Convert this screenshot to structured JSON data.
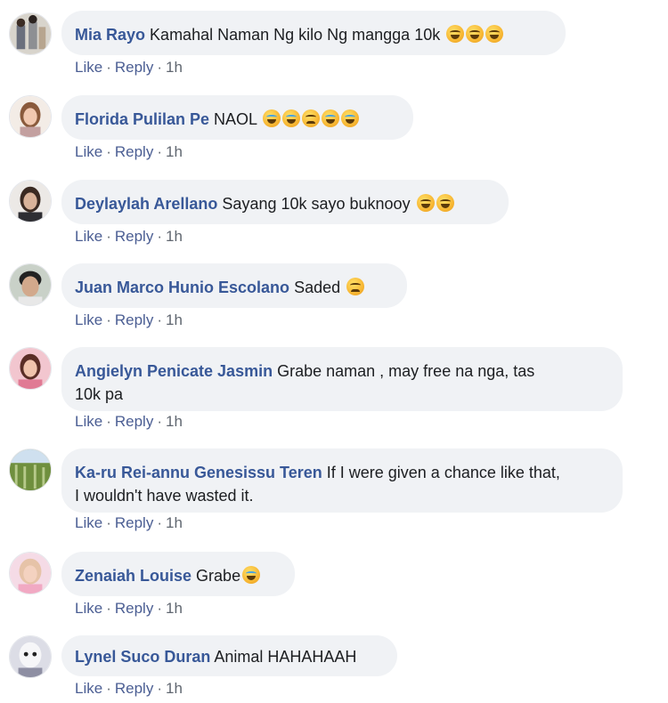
{
  "comments": [
    {
      "author": "Mia Rayo",
      "text": "Kamahal Naman Ng kilo Ng mangga 10k",
      "emoji": "🤣🤣🤣",
      "like": "Like",
      "reply": "Reply",
      "time": "1h"
    },
    {
      "author": "Florida Pulilan Pe",
      "text": "NAOL",
      "emoji": "😂😂😦😂😂",
      "like": "Like",
      "reply": "Reply",
      "time": "1h"
    },
    {
      "author": "Deylaylah Arellano",
      "text": "Sayang 10k sayo buknooy",
      "emoji": "😅🤣",
      "like": "Like",
      "reply": "Reply",
      "time": "1h"
    },
    {
      "author": "Juan Marco Hunio Escolano",
      "text": "Saded",
      "emoji": "😞",
      "like": "Like",
      "reply": "Reply",
      "time": "1h"
    },
    {
      "author": "Angielyn Penicate Jasmin",
      "text": "Grabe naman , may free na nga, tas",
      "text2": "10k pa",
      "like": "Like",
      "reply": "Reply",
      "time": "1h"
    },
    {
      "author": "Ka-ru Rei-annu Genesissu Teren",
      "text": "If I were given a chance like that,",
      "text2": "I wouldn't have wasted it.",
      "like": "Like",
      "reply": "Reply",
      "time": "1h"
    },
    {
      "author": "Zenaiah Louise",
      "text": "Grabe",
      "emoji": "😪",
      "like": "Like",
      "reply": "Reply",
      "time": "1h"
    },
    {
      "author": "Lynel Suco Duran",
      "text": "Animal HAHAHAAH",
      "like": "Like",
      "reply": "Reply",
      "time": "1h"
    }
  ],
  "separator": "·"
}
